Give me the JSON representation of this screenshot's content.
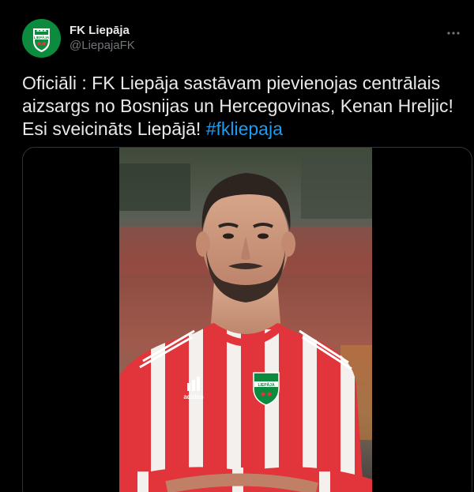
{
  "account": {
    "display_name": "FK Liepāja",
    "handle": "@LiepajaFK",
    "avatar_icon": "fk-liepaja-crest-icon",
    "avatar_crest_text": "LIEPĀJA"
  },
  "tweet": {
    "text_main": "Oficiāli : FK Liepāja sastāvam pievienojas centrālais aizsargs no Bosnijas un Hercegovinas, Kenan Hreljic! Esi sveicināts Liepājā! ",
    "hashtag": "#fkliepaja",
    "more_icon": "more-options-icon"
  },
  "media": {
    "shirt_sponsor": "adidas",
    "shirt_crest_text": "LIEPĀJA"
  },
  "colors": {
    "background": "#000000",
    "text": "#e7e9ea",
    "secondary_text": "#71767b",
    "link": "#1d9bf0",
    "club_green": "#0c8a3e",
    "shirt_red": "#e2353b"
  }
}
